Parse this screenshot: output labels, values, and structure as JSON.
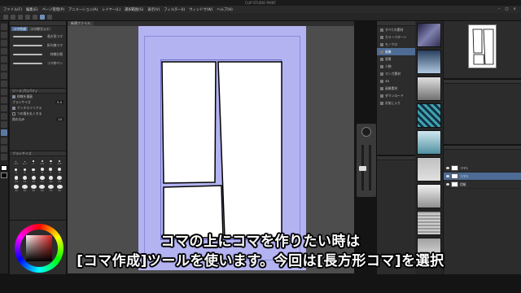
{
  "window": {
    "title": "CLIP STUDIO PAINT"
  },
  "menu": [
    "ファイル(F)",
    "編集(E)",
    "ページ管理(P)",
    "アニメーション(A)",
    "レイヤー(L)",
    "選択範囲(S)",
    "表示(V)",
    "フィルター(I)",
    "ウィンドウ(W)",
    "ヘルプ(H)"
  ],
  "subtool": {
    "tabs": [
      "コマ作成",
      "コマ枠カット"
    ],
    "items": [
      "長方形コマ",
      "折れ線コマ",
      "枠線分割",
      "コマ枠ペン"
    ]
  },
  "tool_property": {
    "header": "ツールプロパティ",
    "rows": [
      {
        "label": "枠線を描画",
        "checked": true
      },
      {
        "label": "ブラシサイズ",
        "value": "5.0"
      },
      {
        "label": "アンチエイリアス",
        "checked": true
      },
      {
        "label": "つの角を丸くする",
        "checked": false
      },
      {
        "label": "角の丸み",
        "value": "10"
      }
    ]
  },
  "brush_size": {
    "header": "ブラシサイズ",
    "sizes": [
      "0.5",
      "0.7",
      "1",
      "1.5",
      "2",
      "2.5",
      "3",
      "4",
      "5",
      "6",
      "7",
      "8",
      "10",
      "12",
      "15",
      "17",
      "20",
      "25",
      "30",
      "40",
      "50",
      "60",
      "70",
      "80"
    ]
  },
  "canvas": {
    "tab_label": "新規ファイル"
  },
  "material": {
    "items": [
      {
        "label": "すべての素材",
        "active": false
      },
      {
        "label": "カラーパターン",
        "active": false
      },
      {
        "label": "モノクロ",
        "active": false
      },
      {
        "label": "画像",
        "active": true
      },
      {
        "label": "背景",
        "active": false
      },
      {
        "label": "人物",
        "active": false
      },
      {
        "label": "マンガ素材",
        "active": false
      },
      {
        "label": "3D",
        "active": false
      },
      {
        "label": "画像素材",
        "active": false
      },
      {
        "label": "ダウンロード",
        "active": false
      },
      {
        "label": "お気に入り",
        "active": false
      }
    ]
  },
  "layers": {
    "rows": [
      {
        "name": "コマ1",
        "active": false
      },
      {
        "name": "コマ2",
        "active": true
      },
      {
        "name": "用紙",
        "active": false
      }
    ]
  },
  "caption": {
    "line1": "コマの上にコマを作りたい時は",
    "line2": "[コマ作成]ツールを使います。今回は[長方形コマ]を選択"
  },
  "accent_color": "#4d6b95",
  "paper_color": "#b3b3f2"
}
